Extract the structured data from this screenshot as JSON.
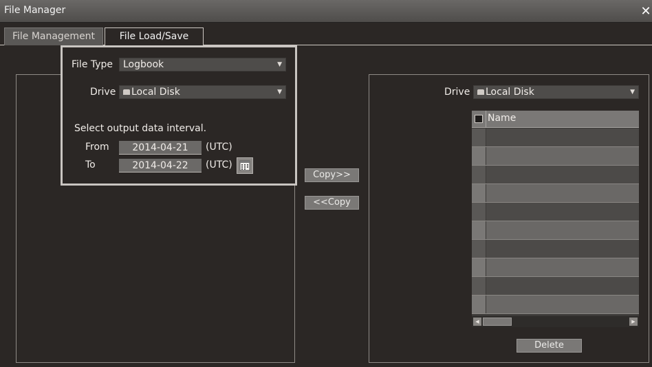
{
  "window": {
    "title": "File Manager",
    "close_glyph": "✕"
  },
  "tabs": [
    {
      "label": "File Management",
      "active": false
    },
    {
      "label": "File Load/Save",
      "active": true
    }
  ],
  "left": {
    "file_type_label": "File Type",
    "file_type_value": "Logbook",
    "drive_label": "Drive",
    "drive_value": "Local Disk",
    "interval_caption": "Select output data interval.",
    "from_label": "From",
    "from_value": "2014-04-21",
    "to_label": "To",
    "to_value": "2014-04-22",
    "utc_label": "(UTC)",
    "calendar_icon": "calendar-icon"
  },
  "center": {
    "copy_right_label": "Copy>>",
    "copy_left_label": "<<Copy"
  },
  "right": {
    "drive_label": "Drive",
    "drive_value": "Local Disk",
    "grid_header_name": "Name",
    "row_count": 10,
    "delete_label": "Delete"
  },
  "colors": {
    "background": "#2b2725",
    "panel_border": "#8f8b87",
    "highlight_border": "#c9c5c1"
  }
}
